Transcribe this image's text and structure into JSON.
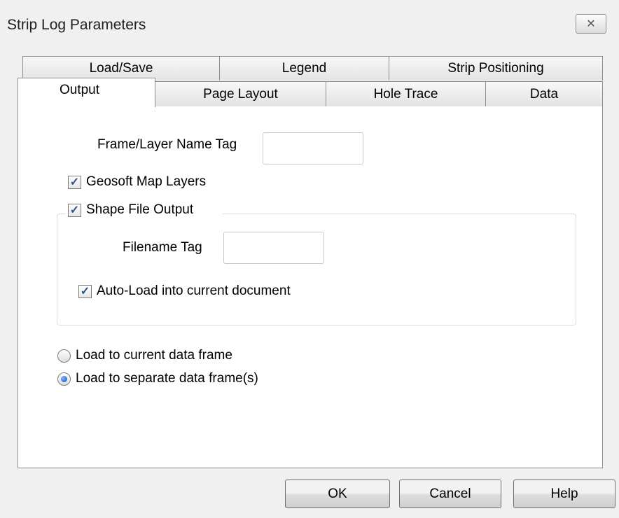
{
  "window": {
    "title": "Strip Log Parameters",
    "close_glyph": "✕"
  },
  "tabs": {
    "row_back": [
      "Load/Save",
      "Legend",
      "Strip Positioning"
    ],
    "row_front": [
      "Output",
      "Page Layout",
      "Hole Trace",
      "Data"
    ],
    "active": "Output"
  },
  "output": {
    "frame_layer_label": "Frame/Layer Name Tag",
    "frame_layer_value": "",
    "geosoft_map_layers": {
      "label": "Geosoft Map Layers",
      "checked": true
    },
    "shape_file_output": {
      "label": "Shape File Output",
      "checked": true
    },
    "filename_tag_label": "Filename Tag",
    "filename_tag_value": "",
    "auto_load": {
      "label": "Auto-Load into current document",
      "checked": true
    },
    "load_options": [
      {
        "label": "Load to current data frame",
        "selected": false
      },
      {
        "label": "Load to separate data frame(s)",
        "selected": true
      }
    ]
  },
  "check_glyph": "✓",
  "buttons": {
    "ok": "OK",
    "cancel": "Cancel",
    "help": "Help"
  }
}
